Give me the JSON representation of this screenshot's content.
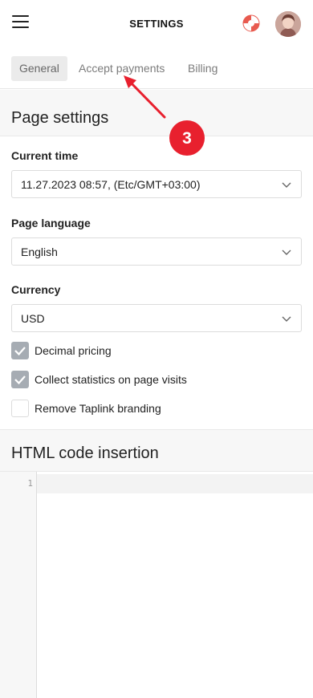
{
  "header": {
    "title": "SETTINGS"
  },
  "tabs": [
    {
      "label": "General",
      "active": true
    },
    {
      "label": "Accept payments",
      "active": false
    },
    {
      "label": "Billing",
      "active": false
    }
  ],
  "page_settings": {
    "heading": "Page settings",
    "current_time": {
      "label": "Current time",
      "value": "11.27.2023 08:57, (Etc/GMT+03:00)"
    },
    "page_language": {
      "label": "Page language",
      "value": "English"
    },
    "currency": {
      "label": "Currency",
      "value": "USD"
    },
    "checkboxes": [
      {
        "label": "Decimal pricing",
        "checked": true
      },
      {
        "label": "Collect statistics on page visits",
        "checked": true
      },
      {
        "label": "Remove Taplink branding",
        "checked": false
      }
    ]
  },
  "html_code": {
    "heading": "HTML code insertion",
    "line_number": "1"
  },
  "annotation": {
    "step": "3",
    "color": "#e8202e"
  },
  "icons": {
    "menu": "hamburger-menu-icon",
    "help": "lifebuoy-icon",
    "dropdown": "chevron-down-icon",
    "check": "checkmark-icon"
  }
}
